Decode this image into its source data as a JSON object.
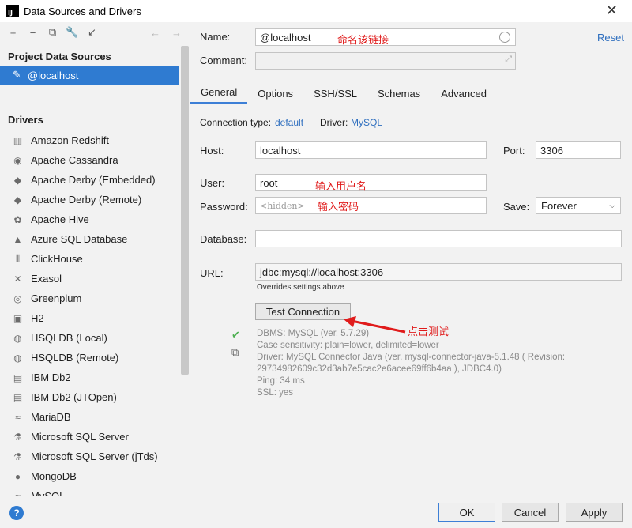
{
  "window": {
    "title": "Data Sources and Drivers",
    "close": "✕",
    "app_icon": "IJ"
  },
  "toolbar": {
    "add": "+",
    "remove": "−",
    "duplicate": "⧉",
    "wrench": "🔧",
    "import": "↙",
    "back": "←",
    "forward": "→"
  },
  "project_sources": {
    "header": "Project Data Sources",
    "items": [
      {
        "label": "@localhost",
        "icon": "mysql-dolphin-icon"
      }
    ]
  },
  "drivers": {
    "header": "Drivers",
    "items": [
      {
        "label": "Amazon Redshift",
        "glyph": "▥"
      },
      {
        "label": "Apache Cassandra",
        "glyph": "◉"
      },
      {
        "label": "Apache Derby (Embedded)",
        "glyph": "◆"
      },
      {
        "label": "Apache Derby (Remote)",
        "glyph": "◆"
      },
      {
        "label": "Apache Hive",
        "glyph": "✿"
      },
      {
        "label": "Azure SQL Database",
        "glyph": "▲"
      },
      {
        "label": "ClickHouse",
        "glyph": "⦀"
      },
      {
        "label": "Exasol",
        "glyph": "✕"
      },
      {
        "label": "Greenplum",
        "glyph": "◎"
      },
      {
        "label": "H2",
        "glyph": "▣"
      },
      {
        "label": "HSQLDB (Local)",
        "glyph": "◍"
      },
      {
        "label": "HSQLDB (Remote)",
        "glyph": "◍"
      },
      {
        "label": "IBM Db2",
        "glyph": "▤"
      },
      {
        "label": "IBM Db2 (JTOpen)",
        "glyph": "▤"
      },
      {
        "label": "MariaDB",
        "glyph": "≈"
      },
      {
        "label": "Microsoft SQL Server",
        "glyph": "⚗"
      },
      {
        "label": "Microsoft SQL Server (jTds)",
        "glyph": "⚗"
      },
      {
        "label": "MongoDB",
        "glyph": "●"
      },
      {
        "label": "MySQL",
        "glyph": "≈"
      }
    ]
  },
  "help": "?",
  "form": {
    "name_label": "Name:",
    "name_value": "@localhost",
    "name_annotation": "命名该链接",
    "reset": "Reset",
    "comment_label": "Comment:",
    "comment_value": "",
    "tabs": [
      "General",
      "Options",
      "SSH/SSL",
      "Schemas",
      "Advanced"
    ],
    "conn_type_label": "Connection type:",
    "conn_type_value": "default",
    "driver_label": "Driver:",
    "driver_value": "MySQL",
    "host_label": "Host:",
    "host_value": "localhost",
    "port_label": "Port:",
    "port_value": "3306",
    "user_label": "User:",
    "user_value": "root",
    "user_annotation": "输入用户名",
    "password_label": "Password:",
    "password_placeholder": "<hidden>",
    "password_annotation": "输入密码",
    "save_label": "Save:",
    "save_value": "Forever",
    "database_label": "Database:",
    "database_value": "",
    "url_label": "URL:",
    "url_value": "jdbc:mysql://localhost:3306",
    "url_note": "Overrides settings above",
    "test_button": "Test Connection",
    "test_annotation": "点击测试",
    "result_lines": [
      "DBMS: MySQL (ver. 5.7.29)",
      "Case sensitivity: plain=lower, delimited=lower",
      "Driver: MySQL Connector Java (ver. mysql-connector-java-5.1.48 ( Revision:",
      "29734982609c32d3ab7e5cac2e6acee69ff6b4aa ), JDBC4.0)",
      "Ping: 34 ms",
      "SSL: yes"
    ]
  },
  "footer": {
    "ok": "OK",
    "cancel": "Cancel",
    "apply": "Apply"
  },
  "colors": {
    "accent": "#2f7bd1",
    "annotation": "#e01b1b",
    "success": "#4caf50"
  }
}
